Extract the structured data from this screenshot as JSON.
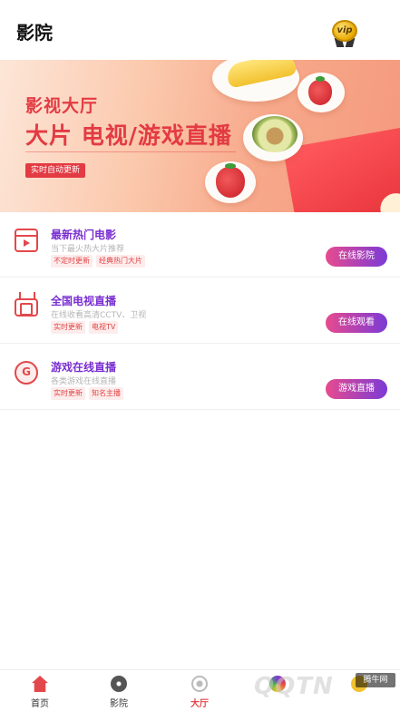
{
  "header": {
    "title": "影院",
    "vip_label": "vip"
  },
  "banner": {
    "line1": "影视大厅",
    "line2": "大片 电视/游戏直播",
    "tag": "实时自动更新",
    "colors": {
      "accent": "#e33b43",
      "background": "#fbc9ad"
    }
  },
  "items": [
    {
      "icon": "film-play-icon",
      "name": "最新热门电影",
      "desc": "当下最火热大片推荐",
      "tags": [
        "不定时更新",
        "经典热门大片"
      ],
      "button": "在线影院"
    },
    {
      "icon": "tv-icon",
      "name": "全国电视直播",
      "desc": "在线收看高清CCTV、卫视",
      "tags": [
        "实时更新",
        "电视TV"
      ],
      "button": "在线观看"
    },
    {
      "icon": "game-shield-icon",
      "name": "游戏在线直播",
      "desc": "各类游戏在线直播",
      "tags": [
        "实时更新",
        "知名主播"
      ],
      "button": "游戏直播"
    }
  ],
  "nav": [
    {
      "label": "首页",
      "icon": "home-icon"
    },
    {
      "label": "影院",
      "icon": "film-reel-icon"
    },
    {
      "label": "大厅",
      "icon": "disc-icon",
      "active": true
    },
    {
      "label": "",
      "icon": "color-circle-icon"
    },
    {
      "label": "",
      "icon": "user-icon"
    }
  ],
  "watermark": "QQTN",
  "corner_badge": "腾牛网",
  "colors": {
    "primary": "#7a2fd1",
    "button_start": "#e74b8f",
    "button_end": "#7b3ad6",
    "active_nav": "#e2484b"
  }
}
